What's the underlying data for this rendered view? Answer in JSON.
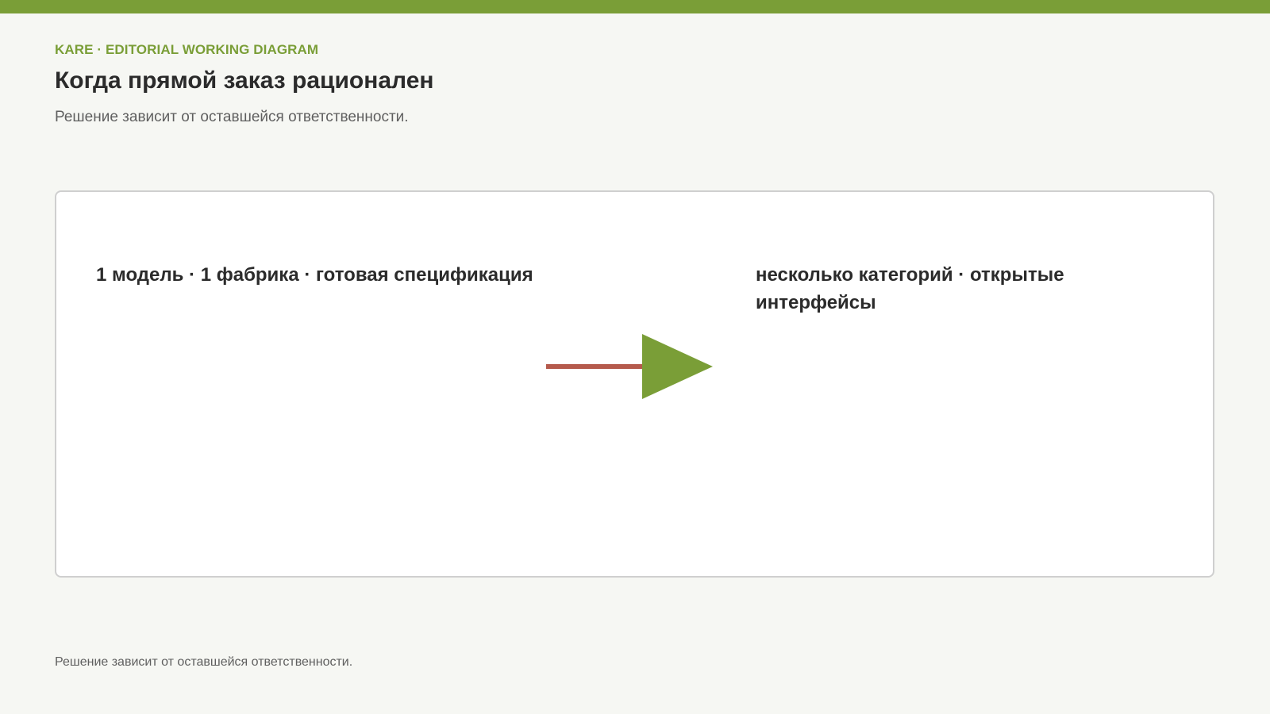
{
  "header": {
    "eyebrow": "KARE · EDITORIAL WORKING DIAGRAM",
    "title": "Когда прямой заказ рационален",
    "subtitle": "Решение зависит от оставшейся ответственности."
  },
  "diagram": {
    "left_node": "1 модель · 1 фабрика · готовая спецификация",
    "right_node": "несколько категорий · открытые интерфейсы",
    "arrow_shaft_color": "#b55a4c",
    "arrow_head_color": "#7a9e37"
  },
  "footer": {
    "note": "Решение зависит от оставшейся ответственности."
  },
  "colors": {
    "accent": "#7a9e37",
    "background": "#f6f7f3",
    "card": "#ffffff",
    "border": "#cfcfcf"
  }
}
